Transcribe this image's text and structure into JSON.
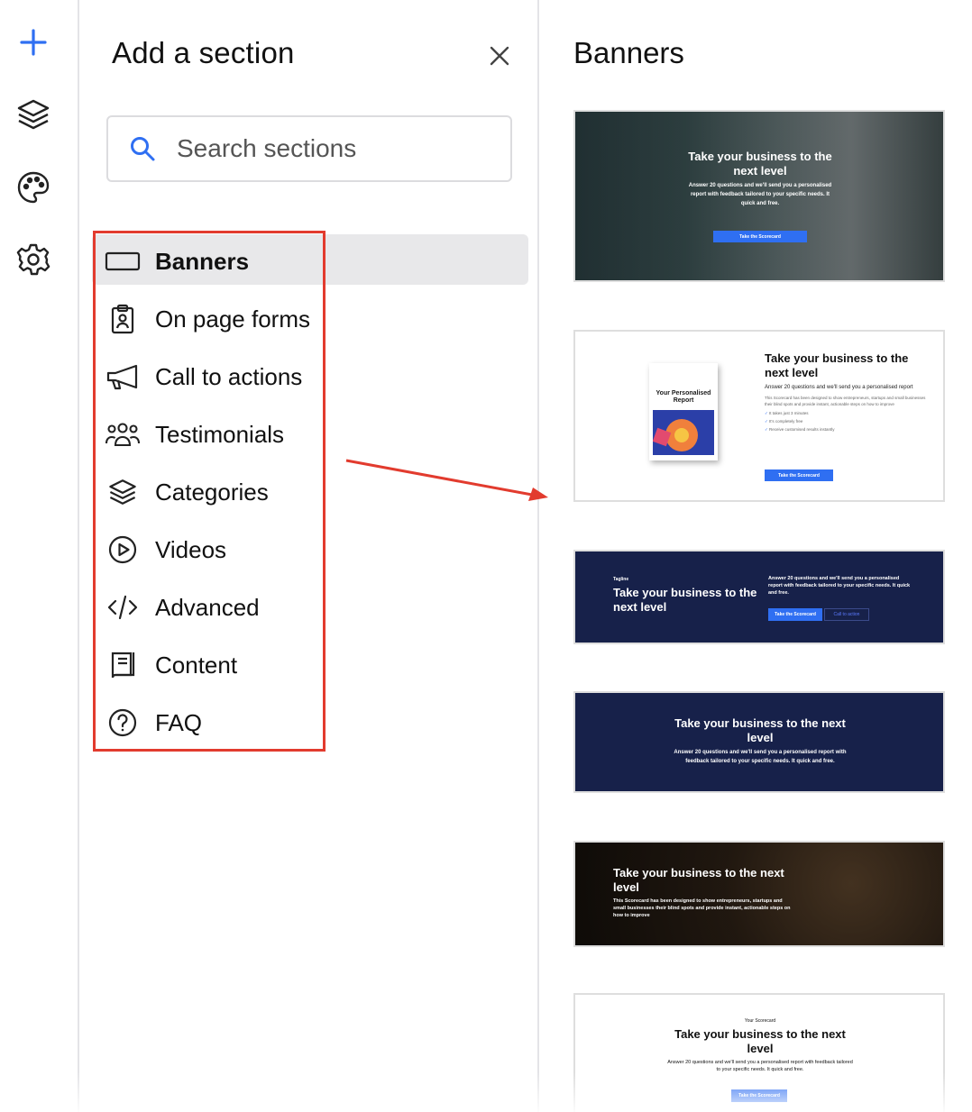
{
  "rail": {
    "items": [
      {
        "name": "add-icon"
      },
      {
        "name": "layers-icon"
      },
      {
        "name": "palette-icon"
      },
      {
        "name": "settings-gear-icon"
      }
    ],
    "accent": "#2f6ff2"
  },
  "panel": {
    "title": "Add a section",
    "search": {
      "placeholder": "Search sections",
      "value": ""
    },
    "categories": [
      {
        "label": "Banners",
        "icon": "banner-rectangle-icon",
        "active": true
      },
      {
        "label": "On page forms",
        "icon": "form-clipboard-icon",
        "active": false
      },
      {
        "label": "Call to actions",
        "icon": "megaphone-icon",
        "active": false
      },
      {
        "label": "Testimonials",
        "icon": "people-group-icon",
        "active": false
      },
      {
        "label": "Categories",
        "icon": "layers-icon",
        "active": false
      },
      {
        "label": "Videos",
        "icon": "play-circle-icon",
        "active": false
      },
      {
        "label": "Advanced",
        "icon": "code-icon",
        "active": false
      },
      {
        "label": "Content",
        "icon": "book-icon",
        "active": false
      },
      {
        "label": "FAQ",
        "icon": "question-circle-icon",
        "active": false
      }
    ]
  },
  "annotation": {
    "highlight_color": "#e23b2e"
  },
  "preview": {
    "title": "Banners",
    "thumbs": [
      {
        "heading": "Take your business to the next level",
        "body": "Answer 20 questions and we'll send you a personalised report with feedback tailored to your specific needs. It quick and free.",
        "button": "Take the Scorecard"
      },
      {
        "report_label": "Your Personalised Report",
        "heading": "Take your business to the next level",
        "body": "Answer 20 questions and we'll send you a personalised report",
        "small": "This Scorecard has been designed to show entrepreneurs, startups and small businesses their blind spots and provide instant, actionable steps on how to improve",
        "checks": [
          "It takes just 3 minutes",
          "It's completely free",
          "Receive customised results instantly"
        ],
        "button": "Take the Scorecard"
      },
      {
        "tagline": "Tagline",
        "heading": "Take your business to the next level",
        "body": "Answer 20 questions and we'll send you a personalised report with feedback tailored to your specific needs. It quick and free.",
        "button": "Take the Scorecard",
        "button2": "Call to action"
      },
      {
        "heading": "Take your business to the next level",
        "body": "Answer 20 questions and we'll send you a personalised report with feedback tailored to your specific needs. It quick and free."
      },
      {
        "heading": "Take your business to the next level",
        "body": "This Scorecard has been designed to show entrepreneurs, startups and small businesses their blind spots and provide instant, actionable steps on how to improve"
      },
      {
        "tagline": "Your Scorecard",
        "heading": "Take your business to the next level",
        "body": "Answer 20 questions and we'll send you a personalised report with feedback tailored to your specific needs. It quick and free.",
        "button": "Take the Scorecard"
      }
    ]
  }
}
